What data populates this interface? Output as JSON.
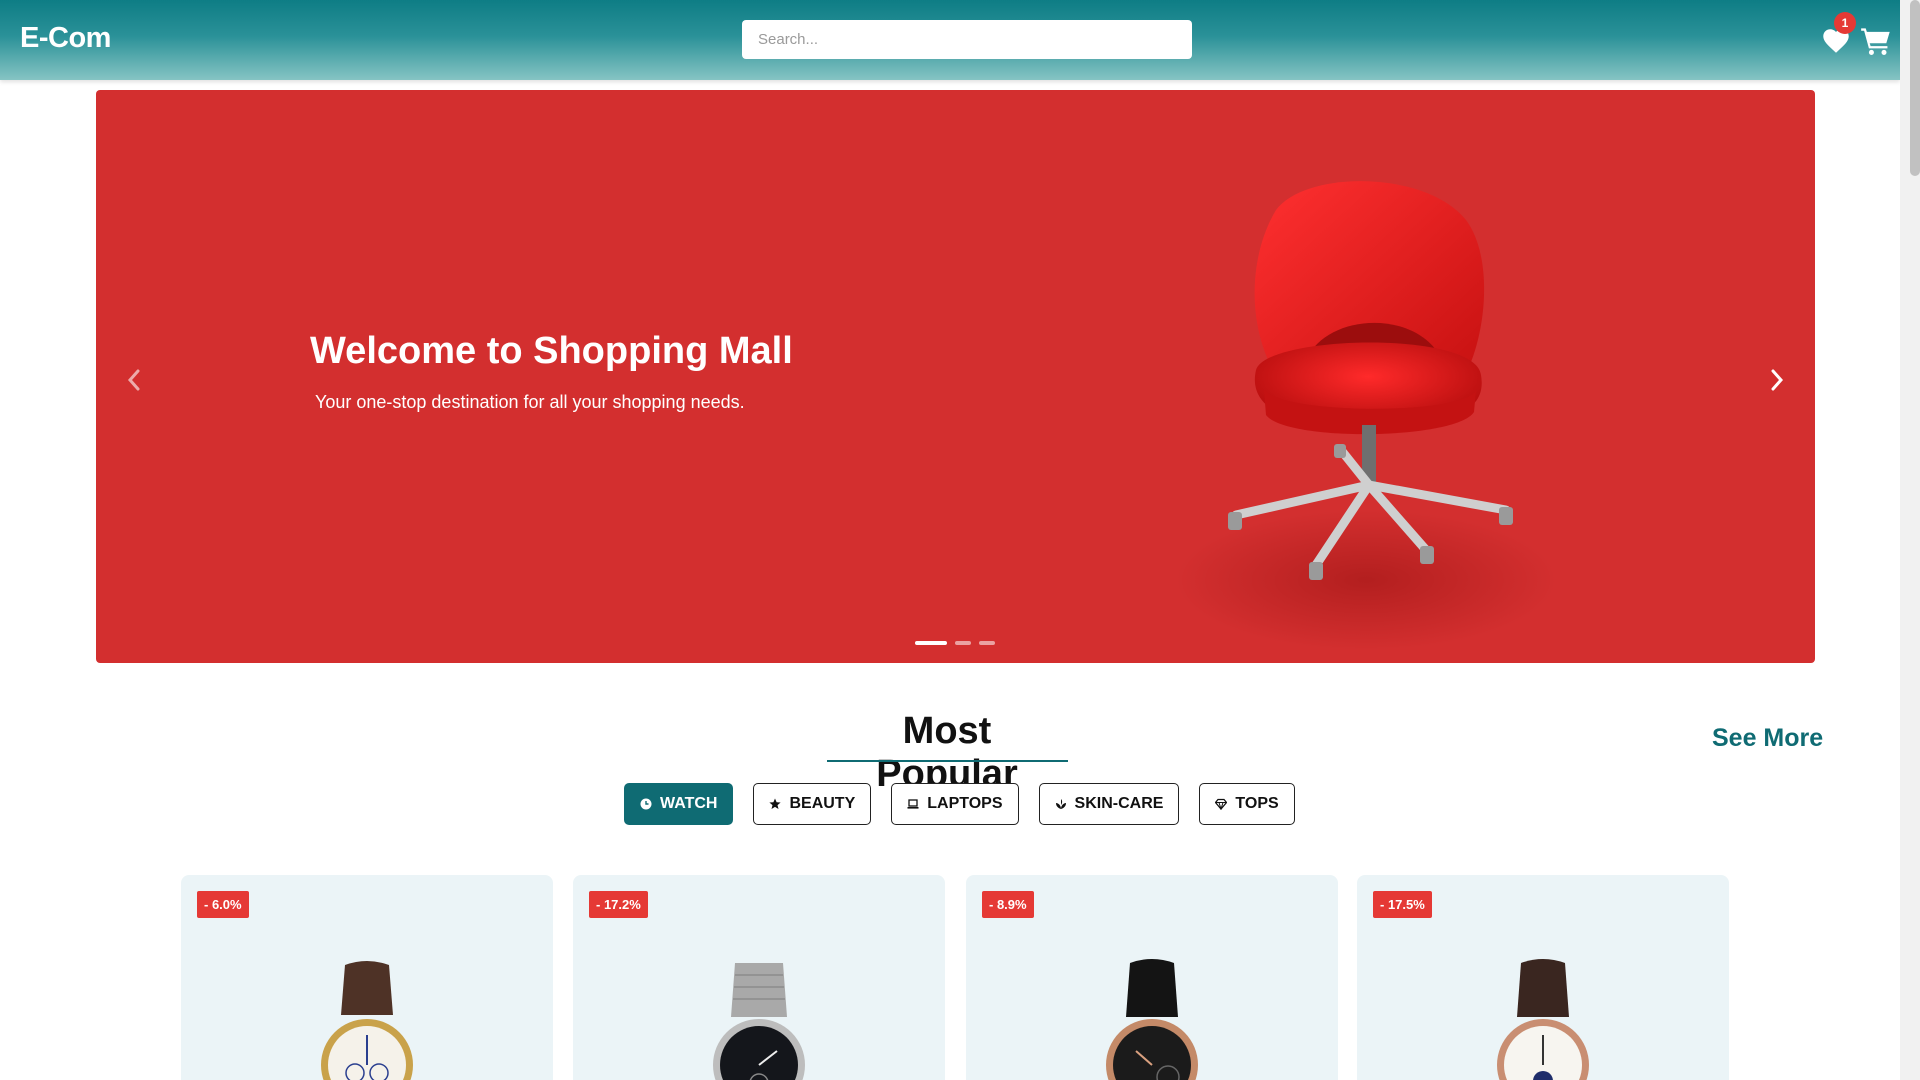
{
  "header": {
    "logo": "E-Com",
    "search_placeholder": "Search...",
    "wishlist_count": "1",
    "wishlist_icon": "heart-icon",
    "cart_icon": "cart-icon",
    "color": "#0e7d85"
  },
  "hero": {
    "title": "Welcome to Shopping Mall",
    "subtitle": "Your one-stop destination for all your shopping needs.",
    "background": "#d32f2f",
    "slides": 3,
    "active_slide": 1
  },
  "popular": {
    "title": "Most Popular",
    "see_more": "See More",
    "categories": [
      {
        "label": "WATCH",
        "icon": "clock-icon",
        "active": true
      },
      {
        "label": "BEAUTY",
        "icon": "star-icon",
        "active": false
      },
      {
        "label": "LAPTOPS",
        "icon": "laptop-icon",
        "active": false
      },
      {
        "label": "SKIN-CARE",
        "icon": "leaf-icon",
        "active": false
      },
      {
        "label": "TOPS",
        "icon": "gem-icon",
        "active": false
      }
    ],
    "products": [
      {
        "discount": "- 6.0%",
        "style": "gold"
      },
      {
        "discount": "- 17.2%",
        "style": "steel"
      },
      {
        "discount": "- 8.9%",
        "style": "rose-dark"
      },
      {
        "discount": "- 17.5%",
        "style": "rose-white"
      }
    ]
  }
}
